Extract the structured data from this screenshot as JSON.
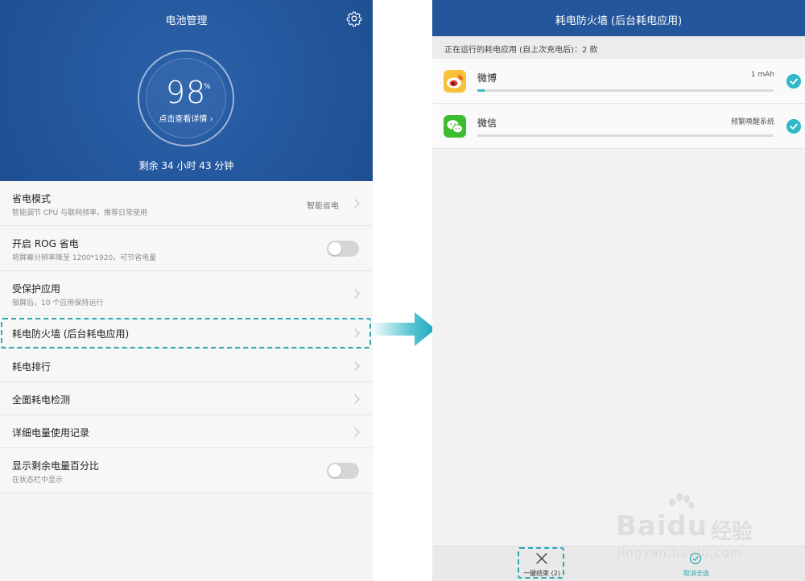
{
  "left": {
    "header_title": "电池管理",
    "battery_percent": "98",
    "percent_sign": "%",
    "detail_link": "点击查看详情 ›",
    "remaining_time": "剩余 34 小时 43 分钟",
    "items": [
      {
        "title": "省电模式",
        "subtitle": "智能调节 CPU 与联网频率，推荐日常使用",
        "value": "智能省电",
        "control": "chevron"
      },
      {
        "title": "开启 ROG 省电",
        "subtitle": "将屏幕分辨率降至 1200*1920，可节省电量",
        "control": "toggle",
        "on": false
      },
      {
        "title": "受保护应用",
        "subtitle": "锁屏后，10 个应用保持运行",
        "control": "chevron"
      },
      {
        "title": "耗电防火墙 (后台耗电应用)",
        "control": "chevron"
      },
      {
        "title": "耗电排行",
        "control": "chevron"
      },
      {
        "title": "全面耗电检测",
        "control": "chevron"
      },
      {
        "title": "详细电量使用记录",
        "control": "chevron"
      },
      {
        "title": "显示剩余电量百分比",
        "subtitle": "在状态栏中显示",
        "control": "toggle",
        "on": false
      }
    ]
  },
  "right": {
    "header_title": "耗电防火墙 (后台耗电应用)",
    "summary": "正在运行的耗电应用 (自上次充电后)：2 款",
    "apps": [
      {
        "name": "微博",
        "value": "1 mAh",
        "usage_fraction": 0.025,
        "checked": true,
        "icon": "weibo-icon"
      },
      {
        "name": "微信",
        "value": "频繁唤醒系统",
        "usage_fraction": 0,
        "checked": true,
        "icon": "wechat-icon"
      }
    ],
    "bottom": {
      "end_all_label": "一键结束 (2)",
      "cancel_select_label": "取消全选"
    }
  },
  "watermark": {
    "brand": "Baidu",
    "cn": "经验",
    "url": "jingyan.baidu.com"
  },
  "colors": {
    "header_blue": "#23569b",
    "accent_teal": "#2fb8c8",
    "highlight_dash": "#2aa8b4"
  }
}
